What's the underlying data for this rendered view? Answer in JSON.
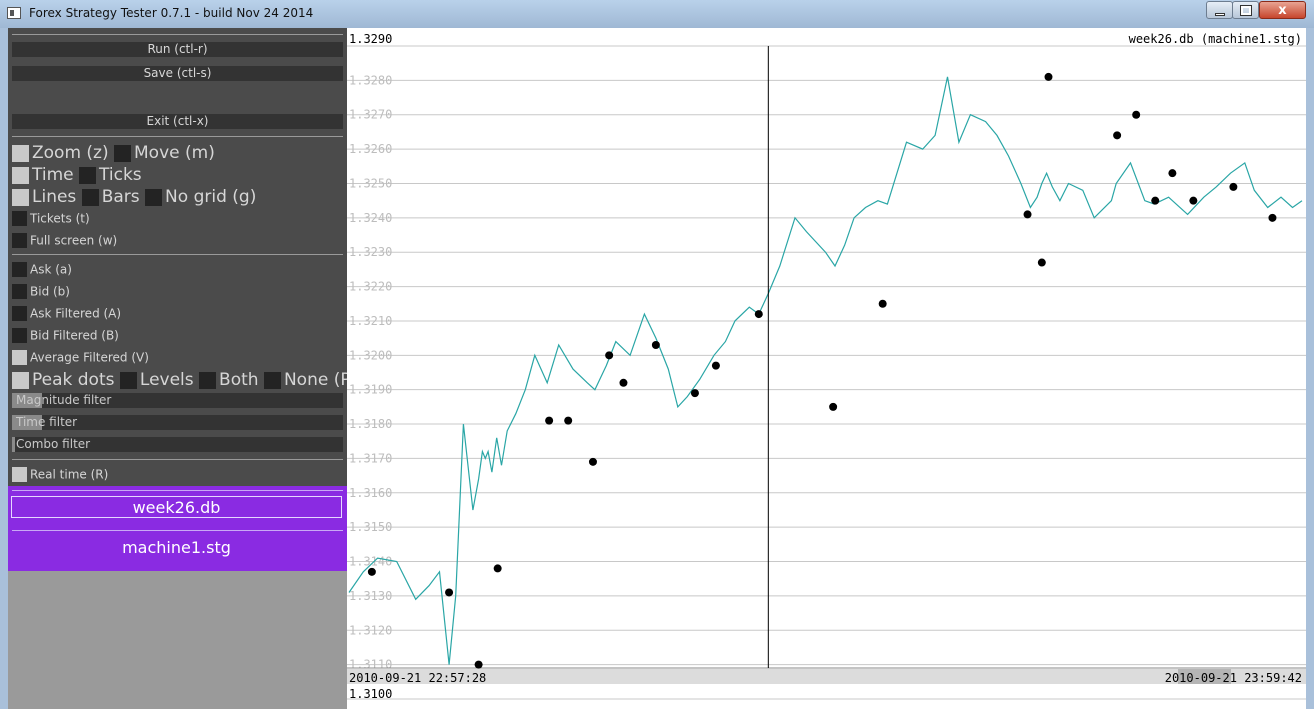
{
  "window": {
    "title": "Forex Strategy Tester 0.7.1 - build Nov 24 2014",
    "close_glyph": "x"
  },
  "panel": {
    "run_label": "Run (ctl-r)",
    "save_label": "Save (ctl-s)",
    "exit_label": "Exit (ctl-x)",
    "view_options": {
      "zoom": {
        "label": "Zoom (z)",
        "checked": true
      },
      "move": {
        "label": "Move (m)",
        "checked": false
      },
      "time": {
        "label": "Time",
        "checked": true
      },
      "ticks": {
        "label": "Ticks",
        "checked": false
      },
      "lines": {
        "label": "Lines",
        "checked": true
      },
      "bars": {
        "label": "Bars",
        "checked": false
      },
      "no_grid": {
        "label": "No grid (g)",
        "checked": false
      },
      "tickets": {
        "label": "Tickets (t)",
        "checked": false
      },
      "full_screen": {
        "label": "Full screen (w)",
        "checked": false
      }
    },
    "series_options": {
      "ask": {
        "label": "Ask (a)",
        "checked": false
      },
      "bid": {
        "label": "Bid (b)",
        "checked": false
      },
      "ask_filtered": {
        "label": "Ask Filtered (A)",
        "checked": false
      },
      "bid_filtered": {
        "label": "Bid Filtered (B)",
        "checked": false
      },
      "average_filtered": {
        "label": "Average Filtered (V)",
        "checked": true
      }
    },
    "peak_options": {
      "peak_dots": {
        "label": "Peak dots",
        "checked": true
      },
      "levels": {
        "label": "Levels",
        "checked": false
      },
      "both": {
        "label": "Both",
        "checked": false
      },
      "none": {
        "label": "None (P)",
        "checked": false
      }
    },
    "filters": {
      "magnitude": {
        "label": "Magnitude filter",
        "level": 0.09
      },
      "time": {
        "label": "Time filter",
        "level": 0.09
      },
      "combo": {
        "label": "Combo filter",
        "level": 0.01
      }
    },
    "real_time": {
      "label": "Real time (R)",
      "checked": true
    },
    "file_label": "week26.db",
    "strategy_label": "machine1.stg"
  },
  "chart": {
    "top_price_label": "1.3290",
    "bottom_price_label": "1.3100",
    "caption": "week26.db (machine1.stg)",
    "time_start": "2010-09-21  22:57:28",
    "time_end": "2010-09-21  23:59:42",
    "line_color": "#2aa6a6",
    "grid_color": "#c8c8c8",
    "dot_color": "#000000",
    "cursor_color": "#000000"
  },
  "chart_data": {
    "type": "line",
    "title": "week26.db (machine1.stg)",
    "xlabel": "",
    "ylabel": "",
    "x_range": [
      "2010-09-21 22:57:28",
      "2010-09-21 23:59:42"
    ],
    "ylim": [
      1.31,
      1.329
    ],
    "y_ticks": [
      "1.3100",
      "1.3110",
      "1.3120",
      "1.3130",
      "1.3140",
      "1.3150",
      "1.3160",
      "1.3170",
      "1.3180",
      "1.3190",
      "1.3200",
      "1.3210",
      "1.3220",
      "1.3230",
      "1.3240",
      "1.3250",
      "1.3260",
      "1.3270",
      "1.3280",
      "1.3290"
    ],
    "grid": true,
    "cursor_fraction": 0.44,
    "series": [
      {
        "values_t": [
          0.0,
          0.015,
          0.03,
          0.05,
          0.07,
          0.084,
          0.095,
          0.105,
          0.112,
          0.12,
          0.13,
          0.136,
          0.14,
          0.143,
          0.146,
          0.15,
          0.155,
          0.16,
          0.166,
          0.175,
          0.185,
          0.195,
          0.208,
          0.22,
          0.235,
          0.25,
          0.258,
          0.27,
          0.28,
          0.295,
          0.31,
          0.322,
          0.335,
          0.345,
          0.355,
          0.368,
          0.383,
          0.395,
          0.405,
          0.42,
          0.43,
          0.44,
          0.452,
          0.468,
          0.48,
          0.5,
          0.51,
          0.52,
          0.53,
          0.542,
          0.555,
          0.565,
          0.585,
          0.602,
          0.615,
          0.628,
          0.64,
          0.652,
          0.668,
          0.68,
          0.692,
          0.705,
          0.715,
          0.722,
          0.727,
          0.732,
          0.738,
          0.746,
          0.755,
          0.77,
          0.782,
          0.8,
          0.805,
          0.82,
          0.835,
          0.845,
          0.86,
          0.88,
          0.897,
          0.91,
          0.925,
          0.94,
          0.95,
          0.964,
          0.978,
          0.99,
          1.0
        ],
        "values": [
          1.3131,
          1.3137,
          1.3141,
          1.314,
          1.3129,
          1.3133,
          1.3137,
          1.311,
          1.313,
          1.318,
          1.3155,
          1.3164,
          1.3172,
          1.317,
          1.3172,
          1.3166,
          1.3176,
          1.3168,
          1.3178,
          1.3183,
          1.319,
          1.32,
          1.3192,
          1.3203,
          1.3196,
          1.3192,
          1.319,
          1.3197,
          1.3204,
          1.32,
          1.3212,
          1.3205,
          1.3196,
          1.3185,
          1.3188,
          1.3193,
          1.32,
          1.3204,
          1.321,
          1.3214,
          1.3212,
          1.3218,
          1.3226,
          1.324,
          1.3236,
          1.323,
          1.3226,
          1.3232,
          1.324,
          1.3243,
          1.3245,
          1.3244,
          1.3262,
          1.326,
          1.3264,
          1.3281,
          1.3262,
          1.327,
          1.3268,
          1.3264,
          1.3258,
          1.325,
          1.3243,
          1.3246,
          1.325,
          1.3253,
          1.3249,
          1.3245,
          1.325,
          1.3248,
          1.324,
          1.3245,
          1.325,
          1.3256,
          1.3245,
          1.3244,
          1.3246,
          1.3241,
          1.3246,
          1.3249,
          1.3253,
          1.3256,
          1.3248,
          1.3243,
          1.3246,
          1.3243,
          1.3245
        ]
      }
    ],
    "peaks_t": [
      0.024,
      0.105,
      0.136,
      0.156,
      0.21,
      0.23,
      0.256,
      0.273,
      0.288,
      0.322,
      0.363,
      0.385,
      0.43,
      0.508,
      0.56,
      0.712,
      0.727,
      0.734,
      0.806,
      0.826,
      0.846,
      0.864,
      0.886,
      0.928,
      0.969
    ],
    "peaks_y": [
      1.3137,
      1.3131,
      1.311,
      1.3138,
      1.3181,
      1.3181,
      1.3169,
      1.32,
      1.3192,
      1.3203,
      1.3189,
      1.3197,
      1.3212,
      1.3185,
      1.3215,
      1.3241,
      1.3227,
      1.3281,
      1.3264,
      1.327,
      1.3245,
      1.3253,
      1.3245,
      1.3249,
      1.324
    ]
  }
}
